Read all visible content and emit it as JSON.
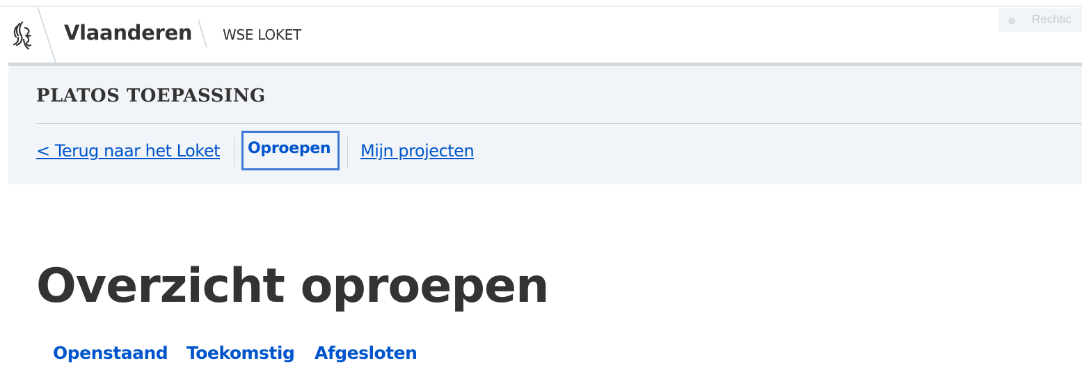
{
  "header": {
    "brand": "Vlaanderen",
    "product": "WSE LOKET",
    "user_label": "Rechtic"
  },
  "app": {
    "title": "PLATOS TOEPASSING"
  },
  "nav": {
    "back_label": "< Terug naar het Loket",
    "oproepen_label": "Oproepen",
    "projects_label": "Mijn projecten",
    "active": "Oproepen"
  },
  "main": {
    "title": "Overzicht oproepen",
    "tabs": [
      {
        "label": "Openstaand"
      },
      {
        "label": "Toekomstig"
      },
      {
        "label": "Afgesloten"
      }
    ]
  },
  "colors": {
    "link": "#0055cc",
    "focus": "#3d78d8",
    "subheader_bg": "#f1f4f8",
    "text": "#333332"
  },
  "icons": {
    "logo": "flemish-lion-icon",
    "user": "user-dot-icon"
  }
}
